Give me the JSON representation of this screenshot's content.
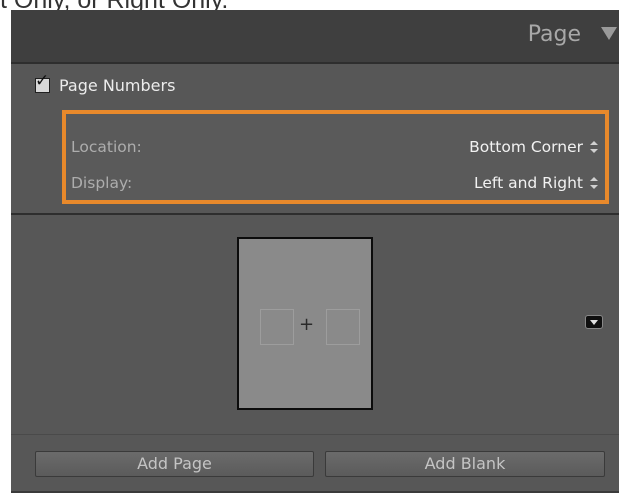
{
  "caption": {
    "text": "t Only, or Right Only."
  },
  "panel": {
    "title": "Page",
    "collapse_icon": "triangle-down-icon"
  },
  "page_numbers": {
    "label": "Page Numbers",
    "checked": true
  },
  "settings": {
    "location_label": "Location:",
    "location_value": "Bottom Corner",
    "display_label": "Display:",
    "display_value": "Left and Right"
  },
  "thumbnail": {
    "plus_glyph": "+"
  },
  "buttons": {
    "add_page": "Add Page",
    "add_blank": "Add Blank"
  },
  "colors": {
    "highlight": "#e8892b",
    "panel_bg": "#575757",
    "header_bg": "#3f3f3f"
  }
}
